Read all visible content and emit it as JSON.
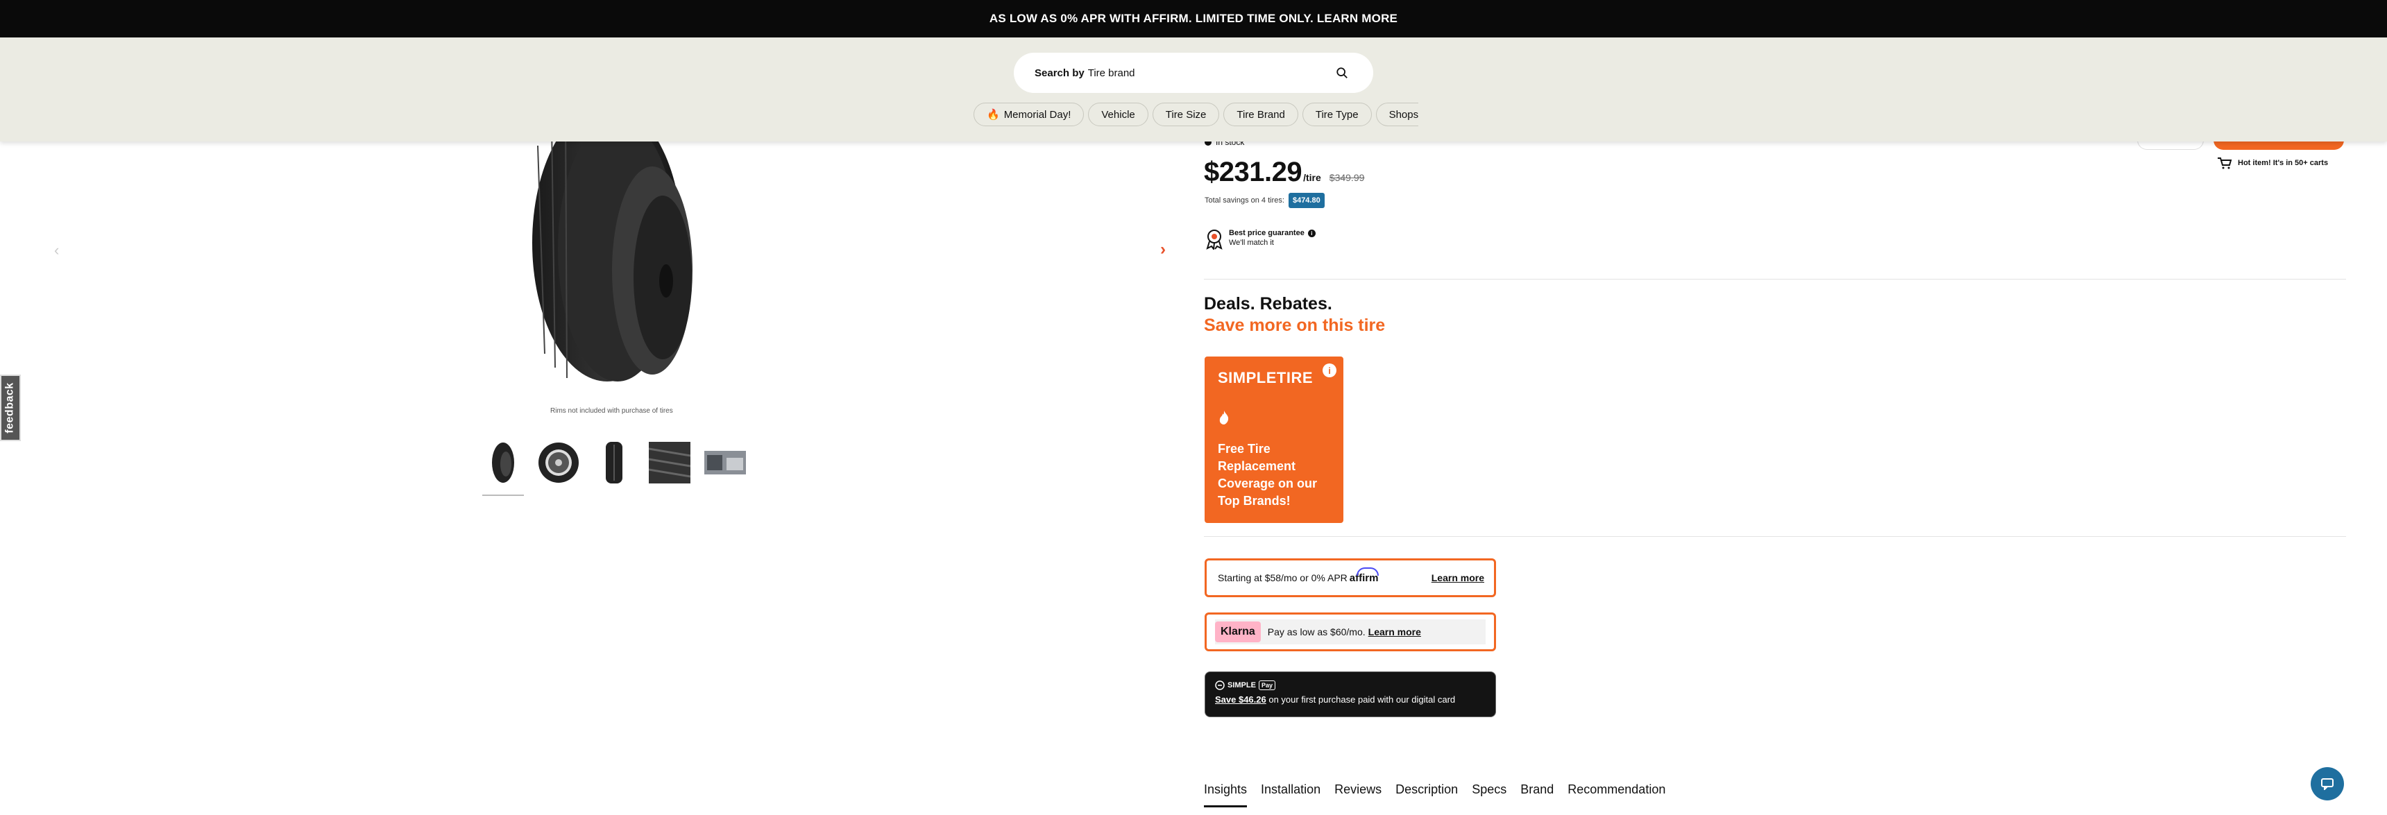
{
  "promo_bar": {
    "text": "AS LOW AS 0% APR WITH AFFIRM. LIMITED TIME ONLY. LEARN MORE"
  },
  "search": {
    "prefix": "Search by",
    "brand": "Tire brand"
  },
  "categories": [
    "Memorial Day!",
    "Vehicle",
    "Tire Size",
    "Tire Brand",
    "Tire Type",
    "Shops"
  ],
  "gallery": {
    "note": "Rims not included with purchase of tires",
    "thumbs": [
      "tire-side-thumb",
      "tire-wheel-thumb",
      "tire-tread-thumb",
      "tread-closeup-thumb",
      "lifestyle-thumb"
    ]
  },
  "feedback": {
    "label": "feedback"
  },
  "product": {
    "stock": "In stock",
    "price": "$231.29",
    "per": "/tire",
    "old_price": "$349.99",
    "savings_label": "Total savings on 4 tires:",
    "savings_value": "$474.80",
    "guarantee_title": "Best price guarantee",
    "guarantee_sub": "We'll match it",
    "hot_item": "Hot item! It's in 50+ carts"
  },
  "deals": {
    "title": "Deals. Rebates.",
    "subtitle": "Save more on this tire",
    "card_logo": "SIMPLETIRE",
    "card_message": "Free Tire Replacement Coverage on our Top Brands!"
  },
  "affirm": {
    "text": "Starting at $58/mo or 0% APR",
    "logo": "affirm",
    "link": "Learn more"
  },
  "klarna": {
    "logo": "Klarna",
    "text": "Pay as low as $60/mo.",
    "link": "Learn more"
  },
  "simplepay": {
    "logo": "SIMPLE",
    "pay": "Pay",
    "save": "Save $46.26",
    "text": " on your first purchase paid with our digital card"
  },
  "tabs": [
    "Insights",
    "Installation",
    "Reviews",
    "Description",
    "Specs",
    "Brand",
    "Recommendation"
  ],
  "colors": {
    "accent": "#f26722",
    "badge": "#1f6f9f",
    "header_bg": "#ebebe3"
  }
}
